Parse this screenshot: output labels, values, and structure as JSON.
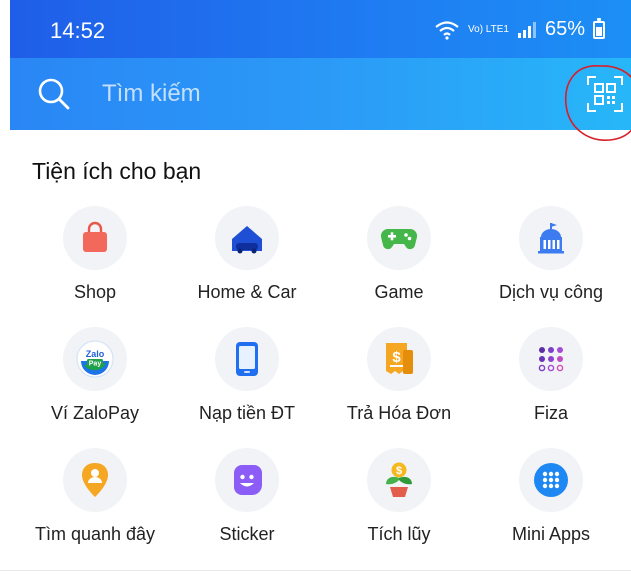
{
  "status_bar": {
    "time": "14:52",
    "network_label_top": "Vo) LTE1",
    "battery": "65%"
  },
  "search": {
    "placeholder": "Tìm kiếm"
  },
  "section": {
    "title": "Tiện ích cho bạn"
  },
  "utilities": [
    {
      "label": "Shop",
      "icon": "shopping-bag-icon"
    },
    {
      "label": "Home & Car",
      "icon": "home-car-icon"
    },
    {
      "label": "Game",
      "icon": "gamepad-icon"
    },
    {
      "label": "Dịch vụ công",
      "icon": "government-building-icon"
    },
    {
      "label": "Ví ZaloPay",
      "icon": "zalopay-wallet-icon",
      "icon_text": "Zalo Pay"
    },
    {
      "label": "Nạp tiền ĐT",
      "icon": "phone-topup-icon"
    },
    {
      "label": "Trả Hóa Đơn",
      "icon": "bill-payment-icon"
    },
    {
      "label": "Fiza",
      "icon": "fiza-dots-icon"
    },
    {
      "label": "Tìm quanh đây",
      "icon": "nearby-location-icon"
    },
    {
      "label": "Sticker",
      "icon": "sticker-smile-icon"
    },
    {
      "label": "Tích lũy",
      "icon": "savings-plant-icon"
    },
    {
      "label": "Mini Apps",
      "icon": "mini-apps-grid-icon"
    }
  ],
  "colors": {
    "header_blue": "#1f6ff0",
    "search_blue": "#2b9cf7",
    "annotation_red": "#d81e2a"
  }
}
